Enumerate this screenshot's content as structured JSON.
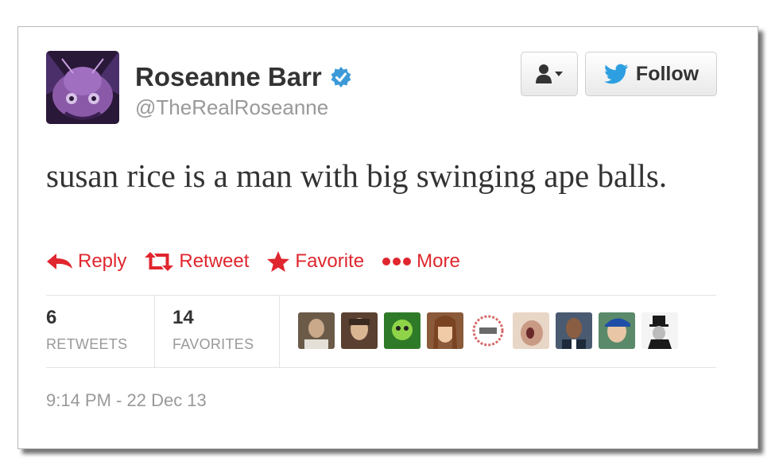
{
  "user": {
    "name": "Roseanne Barr",
    "handle": "@TheRealRoseanne",
    "verified": true,
    "avatar_icon": "purple-creature-avatar"
  },
  "buttons": {
    "user_menu_icon": "person-icon",
    "follow_label": "Follow"
  },
  "tweet": {
    "text": "susan rice is a man with big swinging ape balls."
  },
  "actions": [
    {
      "label": "Reply",
      "icon": "reply-icon"
    },
    {
      "label": "Retweet",
      "icon": "retweet-icon"
    },
    {
      "label": "Favorite",
      "icon": "star-icon"
    },
    {
      "label": "More",
      "icon": "more-dots-icon"
    }
  ],
  "stats": {
    "retweets_count": "6",
    "retweets_label": "RETWEETS",
    "favorites_count": "14",
    "favorites_label": "FAVORITES"
  },
  "timestamp": "9:14 PM - 22 Dec 13",
  "colors": {
    "action_red": "#e0262e",
    "verified_blue": "#3d9ad8",
    "text_dark": "#333333",
    "text_muted": "#999999"
  }
}
